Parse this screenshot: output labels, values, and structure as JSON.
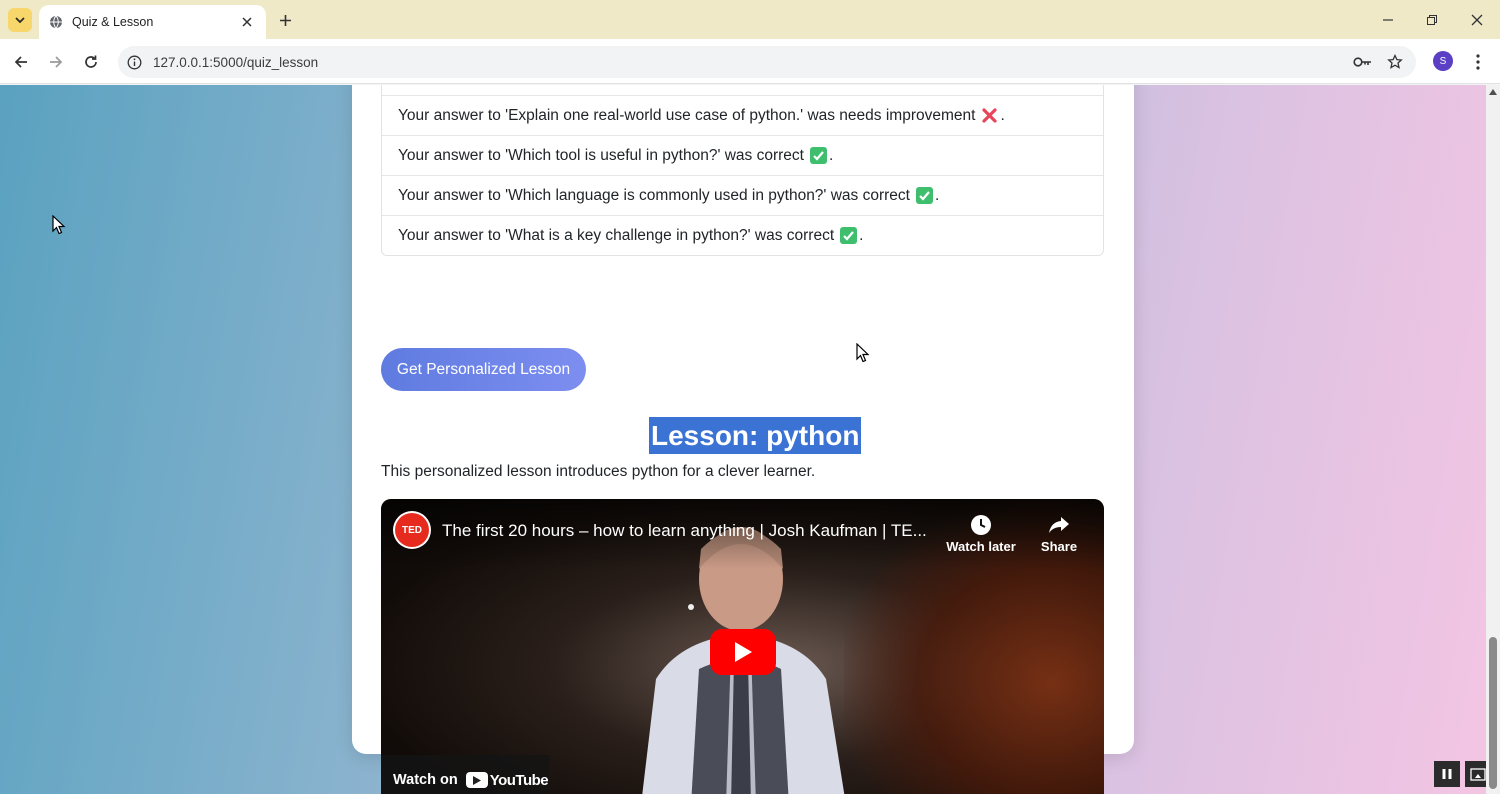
{
  "browser": {
    "tab_title": "Quiz & Lesson",
    "url": "127.0.0.1:5000/quiz_lesson",
    "profile_initial": "S"
  },
  "page": {
    "answers": [
      {
        "text": "",
        "mark": ""
      },
      {
        "text": "Your answer to 'Explain one real-world use case of python.' was needs improvement",
        "mark": "bad"
      },
      {
        "text": "Your answer to 'Which tool is useful in python?' was correct",
        "mark": "ok"
      },
      {
        "text": "Your answer to 'Which language is commonly used in python?' was correct",
        "mark": "ok"
      },
      {
        "text": "Your answer to 'What is a key challenge in python?' was correct",
        "mark": "ok"
      }
    ],
    "lesson_button": "Get Personalized Lesson",
    "lesson_title": "Lesson: python",
    "lesson_description": "This personalized lesson introduces python for a clever learner."
  },
  "video": {
    "channel_logo": "TED",
    "title": "The first 20 hours – how to learn anything | Josh Kaufman | TE...",
    "watch_later_label": "Watch later",
    "share_label": "Share",
    "watch_on_label": "Watch on",
    "youtube_label": "YouTube"
  },
  "colors": {
    "accent": "#5f7be0",
    "selection": "#3a73d4",
    "correct": "#3fbf6e",
    "incorrect": "#e8445a",
    "youtube_red": "#ff0000"
  }
}
